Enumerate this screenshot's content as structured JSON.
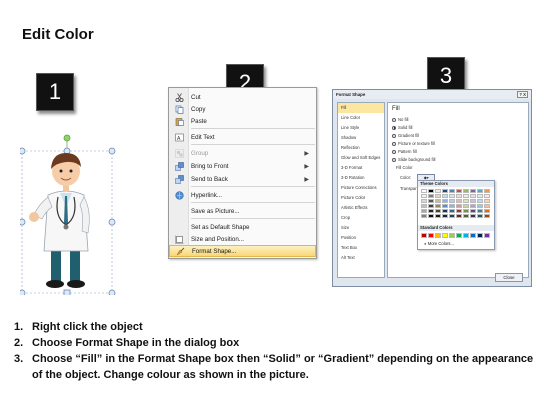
{
  "title": "Edit Color",
  "badges": {
    "step1": "1",
    "step2": "2",
    "step3": "3"
  },
  "context_menu": {
    "items": [
      {
        "label": "Cut",
        "icon": "scissors-icon",
        "disabled": false,
        "submenu": false
      },
      {
        "label": "Copy",
        "icon": "copy-icon",
        "disabled": false,
        "submenu": false
      },
      {
        "label": "Paste",
        "icon": "paste-icon",
        "disabled": false,
        "submenu": false
      },
      {
        "label": "Edit Text",
        "icon": "edit-text-icon",
        "disabled": false,
        "submenu": false
      },
      {
        "label": "Group",
        "icon": "group-icon",
        "disabled": true,
        "submenu": true
      },
      {
        "label": "Bring to Front",
        "icon": "bring-to-front-icon",
        "disabled": false,
        "submenu": true
      },
      {
        "label": "Send to Back",
        "icon": "send-to-back-icon",
        "disabled": false,
        "submenu": true
      },
      {
        "label": "Hyperlink...",
        "icon": "hyperlink-icon",
        "disabled": false,
        "submenu": false
      },
      {
        "label": "Save as Picture...",
        "icon": "",
        "disabled": false,
        "submenu": false
      },
      {
        "label": "Set as Default Shape",
        "icon": "",
        "disabled": false,
        "submenu": false
      },
      {
        "label": "Size and Position...",
        "icon": "size-position-icon",
        "disabled": false,
        "submenu": false
      },
      {
        "label": "Format Shape...",
        "icon": "format-shape-icon",
        "disabled": false,
        "submenu": false,
        "highlighted": true
      }
    ]
  },
  "dialog": {
    "title": "Format Shape",
    "title_buttons": "? X",
    "left_items": [
      "Fill",
      "Line Color",
      "Line Style",
      "Shadow",
      "Reflection",
      "Glow and Soft Edges",
      "3-D Format",
      "3-D Rotation",
      "Picture Corrections",
      "Picture Color",
      "Artistic Effects",
      "Crop",
      "Size",
      "Position",
      "Text Box",
      "Alt Text"
    ],
    "selected_left": "Fill",
    "fill_heading": "Fill",
    "options": [
      {
        "label": "No fill",
        "checked": false
      },
      {
        "label": "Solid fill",
        "checked": true
      },
      {
        "label": "Gradient fill",
        "checked": false
      },
      {
        "label": "Picture or texture fill",
        "checked": false
      },
      {
        "label": "Pattern fill",
        "checked": false
      },
      {
        "label": "Slide background fill",
        "checked": false
      }
    ],
    "fill_color_label": "Fill Color",
    "color_label": "Color:",
    "transparency_label": "Transpar",
    "close_label": "Close"
  },
  "palette": {
    "theme_label": "Theme Colors",
    "standard_label": "Standard Colors",
    "more_label": "More Colors...",
    "theme_columns": [
      "#ffffff",
      "#000000",
      "#eeece1",
      "#1f497d",
      "#4f81bd",
      "#c0504d",
      "#9bbb59",
      "#8064a2",
      "#4bacc6",
      "#f79646"
    ],
    "theme_rows": [
      [
        "#ffffff",
        "#000000",
        "#eeece1",
        "#1f497d",
        "#4f81bd",
        "#c0504d",
        "#9bbb59",
        "#8064a2",
        "#4bacc6",
        "#f79646"
      ],
      [
        "#f2f2f2",
        "#7f7f7f",
        "#ddd9c3",
        "#c6d9f0",
        "#dbe5f1",
        "#f2dcdb",
        "#ebf1dd",
        "#e5e0ec",
        "#dbeef3",
        "#fdeada"
      ],
      [
        "#d8d8d8",
        "#595959",
        "#c4bd97",
        "#8db3e2",
        "#b8cce4",
        "#e5b9b7",
        "#d7e3bc",
        "#ccc1d9",
        "#b7dde8",
        "#fbd5b5"
      ],
      [
        "#bfbfbf",
        "#3f3f3f",
        "#938953",
        "#548dd4",
        "#95b3d7",
        "#d99694",
        "#c3d69b",
        "#b2a2c7",
        "#92cddc",
        "#fac08f"
      ],
      [
        "#a5a5a5",
        "#262626",
        "#494429",
        "#17365d",
        "#366092",
        "#953734",
        "#76923c",
        "#5f497a",
        "#31859b",
        "#e36c09"
      ],
      [
        "#7f7f7f",
        "#0c0c0c",
        "#1d1b10",
        "#0f243e",
        "#244061",
        "#632423",
        "#4f6128",
        "#3f3151",
        "#205867",
        "#974806"
      ]
    ],
    "standard": [
      "#c00000",
      "#ff0000",
      "#ffc000",
      "#ffff00",
      "#92d050",
      "#00b050",
      "#00b0f0",
      "#0070c0",
      "#002060",
      "#7030a0"
    ]
  },
  "instructions": [
    {
      "num": "1.",
      "text": "Right click the object"
    },
    {
      "num": "2.",
      "text": "Choose Format Shape in the dialog box"
    },
    {
      "num": "3.",
      "text": "Choose “Fill” in the Format Shape box then “Solid” or “Gradient” depending on the appearance of the object. Change colour as shown in the picture."
    }
  ]
}
